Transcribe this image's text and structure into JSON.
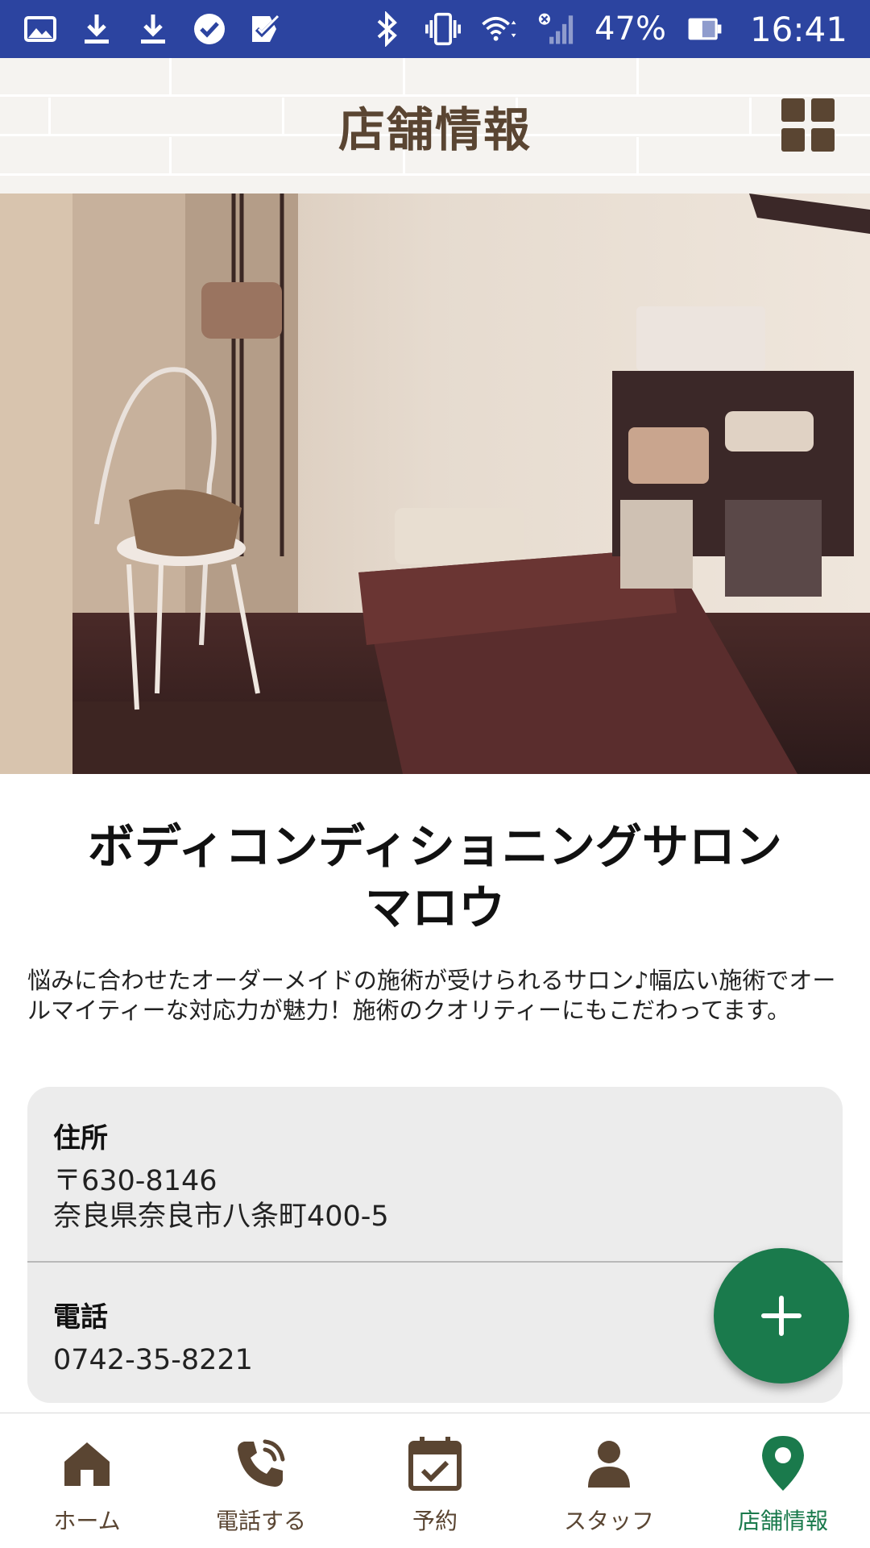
{
  "status_bar": {
    "battery": "47%",
    "time": "16:41",
    "left_icons": [
      "gallery-icon",
      "download-icon",
      "download-icon",
      "check-circle-icon",
      "task-check-icon"
    ],
    "right_icons": [
      "bluetooth-icon",
      "vibrate-icon",
      "wifi-icon",
      "signal-icon",
      "battery-icon"
    ]
  },
  "header": {
    "title": "店舗情報",
    "menu_icon": "grid-icon"
  },
  "shop": {
    "name_line1": "ボディコンディショニングサロン",
    "name_line2": "マロウ",
    "description": "悩みに合わせたオーダーメイドの施術が受けられるサロン♪幅広い施術でオールマイティーな対応力が魅力！施術のクオリティーにもこだわってます。"
  },
  "info": {
    "address_label": "住所",
    "postal_code": "〒630-8146",
    "address": "奈良県奈良市八条町400-5",
    "phone_label": "電話",
    "phone": "0742-35-8221"
  },
  "fab": {
    "icon": "plus-icon"
  },
  "nav": {
    "items": [
      {
        "label": "ホーム",
        "icon": "home-icon"
      },
      {
        "label": "電話する",
        "icon": "phone-icon"
      },
      {
        "label": "予約",
        "icon": "calendar-check-icon"
      },
      {
        "label": "スタッフ",
        "icon": "person-icon"
      },
      {
        "label": "店舗情報",
        "icon": "location-pin-icon"
      }
    ],
    "active_index": 4
  },
  "colors": {
    "status_bar": "#2c44a0",
    "brown": "#5a4532",
    "green": "#1a7a4c",
    "card": "#ececec"
  }
}
